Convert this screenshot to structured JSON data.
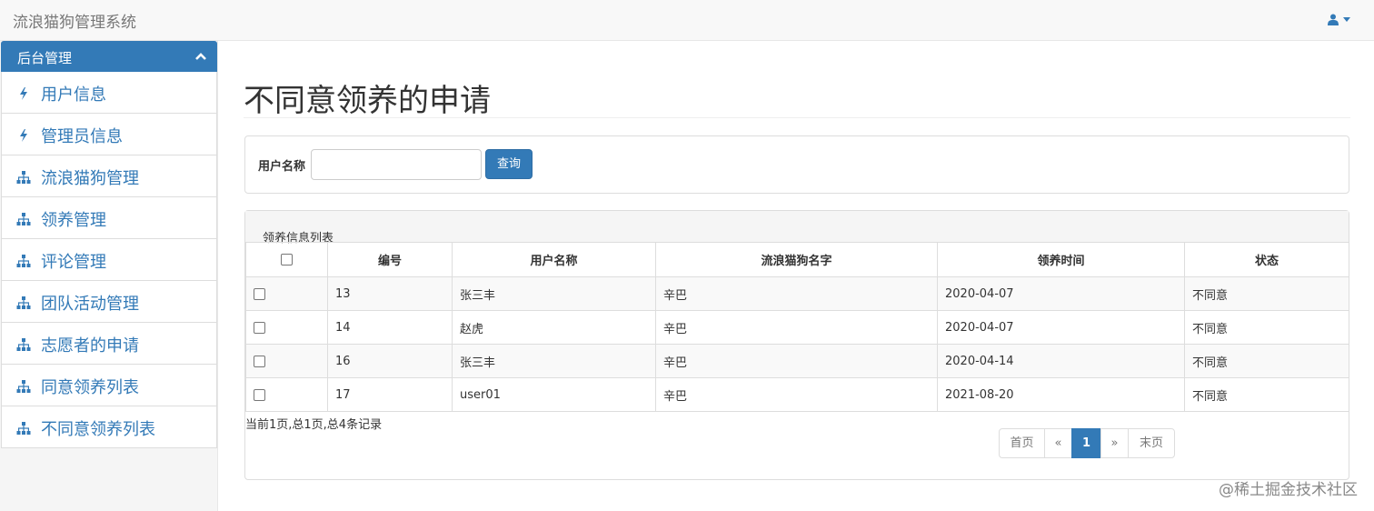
{
  "navbar": {
    "brand": "流浪猫狗管理系统"
  },
  "sidebar": {
    "header": "后台管理",
    "items": [
      {
        "label": "用户信息",
        "icon": "bolt-icon"
      },
      {
        "label": "管理员信息",
        "icon": "bolt-icon"
      },
      {
        "label": "流浪猫狗管理",
        "icon": "sitemap-icon"
      },
      {
        "label": "领养管理",
        "icon": "sitemap-icon"
      },
      {
        "label": "评论管理",
        "icon": "sitemap-icon"
      },
      {
        "label": "团队活动管理",
        "icon": "sitemap-icon"
      },
      {
        "label": "志愿者的申请",
        "icon": "sitemap-icon"
      },
      {
        "label": "同意领养列表",
        "icon": "sitemap-icon"
      },
      {
        "label": "不同意领养列表",
        "icon": "sitemap-icon"
      }
    ]
  },
  "page": {
    "title": "不同意领养的申请"
  },
  "search": {
    "label": "用户名称",
    "value": "",
    "button": "查询"
  },
  "list": {
    "title": "领养信息列表",
    "columns": [
      "编号",
      "用户名称",
      "流浪猫狗名字",
      "领养时间",
      "状态"
    ],
    "rows": [
      {
        "id": "13",
        "user": "张三丰",
        "pet": "辛巴",
        "date": "2020-04-07",
        "status": "不同意"
      },
      {
        "id": "14",
        "user": "赵虎",
        "pet": "辛巴",
        "date": "2020-04-07",
        "status": "不同意"
      },
      {
        "id": "16",
        "user": "张三丰",
        "pet": "辛巴",
        "date": "2020-04-14",
        "status": "不同意"
      },
      {
        "id": "17",
        "user": "user01",
        "pet": "辛巴",
        "date": "2021-08-20",
        "status": "不同意"
      }
    ],
    "records_info": "当前1页,总1页,总4条记录"
  },
  "pagination": {
    "first": "首页",
    "prev": "«",
    "current": "1",
    "next": "»",
    "last": "末页"
  },
  "watermark": "@稀土掘金技术社区",
  "colors": {
    "primary": "#337ab7",
    "navbar_bg": "#f8f8f8",
    "border": "#dddddd"
  }
}
